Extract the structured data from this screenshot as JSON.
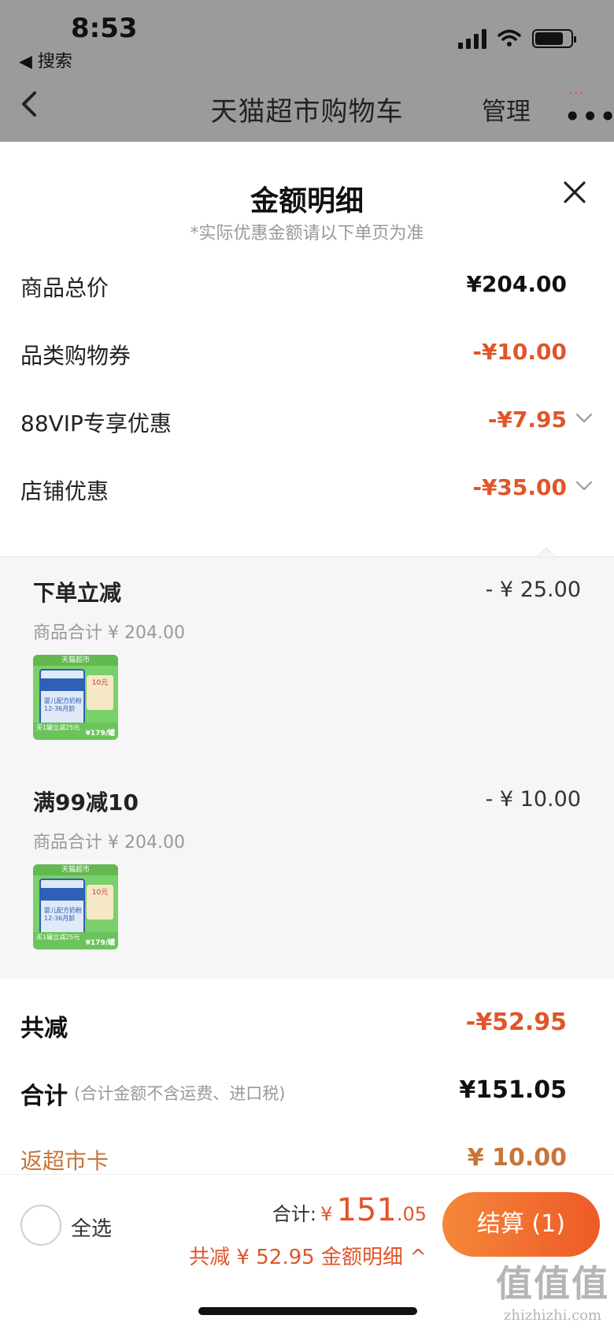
{
  "status_bar": {
    "time": "8:53",
    "back_app": "◀ 搜索"
  },
  "nav": {
    "title": "天猫超市购物车",
    "manage": "管理"
  },
  "sheet": {
    "title": "金额明细",
    "note": "*实际优惠金额请以下单页为准",
    "rows": [
      {
        "label": "商品总价",
        "value": "¥204.00"
      },
      {
        "label": "品类购物券",
        "value": "-¥10.00"
      },
      {
        "label": "88VIP专享优惠",
        "value": "-¥7.95"
      },
      {
        "label": "店铺优惠",
        "value": "-¥35.00"
      }
    ],
    "promos": [
      {
        "title": "下单立减",
        "amount": "- ¥ 25.00",
        "subtotal": "商品合计 ¥ 204.00"
      },
      {
        "title": "满99减10",
        "amount": "- ¥ 10.00",
        "subtotal": "商品合计 ¥ 204.00"
      }
    ],
    "product_thumb": {
      "store_tag": "天猫超市",
      "brand": "Aptamil 爱他美",
      "can_text": "婴儿配方奶粉 12-36月龄",
      "badge": "10元",
      "promo": "买1罐立减25元",
      "price": "¥179/罐"
    },
    "total_saved": {
      "label": "共减",
      "value": "-¥52.95"
    },
    "grand_total": {
      "label": "合计",
      "note": "(合计金额不含运费、进口税)",
      "value": "¥151.05"
    },
    "rebate": {
      "label": "返超市卡",
      "value": "¥ 10.00"
    }
  },
  "bottom_bar": {
    "select_all": "全选",
    "total_label": "合计:",
    "currency": "¥",
    "total_int": "151",
    "total_dec": ".05",
    "saved_text": "共减 ¥ 52.95  金额明细 ^",
    "checkout": "结算 (1)"
  },
  "watermark": {
    "logo": "值值值",
    "site": "zhizhizhi.com"
  },
  "colors": {
    "accent": "#e0552a",
    "rebate": "#c8743a",
    "dim": "#9b9b9b"
  }
}
